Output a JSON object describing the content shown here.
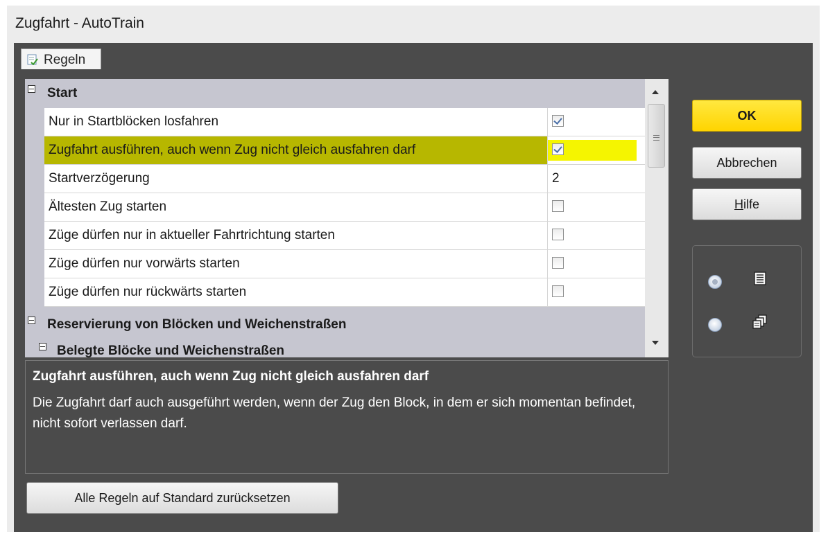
{
  "window": {
    "title": "Zugfahrt - AutoTrain"
  },
  "tabs": [
    {
      "label": "Regeln"
    }
  ],
  "grid": {
    "categories": [
      {
        "label": "Start"
      },
      {
        "label": "Reservierung von Blöcken und Weichenstraßen"
      },
      {
        "label": "Belegte Blöcke und Weichenstraßen"
      }
    ],
    "rows": [
      {
        "label": "Nur in Startblöcken losfahren",
        "checked": true
      },
      {
        "label": "Zugfahrt ausführen, auch wenn Zug nicht gleich ausfahren darf",
        "checked": true,
        "selected": true
      },
      {
        "label": "Startverzögerung",
        "value": "2"
      },
      {
        "label": "Ältesten Zug starten",
        "checked": false
      },
      {
        "label": "Züge dürfen nur in aktueller Fahrtrichtung starten",
        "checked": false
      },
      {
        "label": "Züge dürfen nur vorwärts starten",
        "checked": false
      },
      {
        "label": "Züge dürfen nur rückwärts starten",
        "checked": false
      }
    ]
  },
  "description": {
    "title": "Zugfahrt ausführen, auch wenn Zug nicht gleich ausfahren darf",
    "text": "Die Zugfahrt darf auch ausgeführt werden, wenn der Zug den Block, in dem er sich momentan befindet, nicht sofort verlassen darf."
  },
  "buttons": {
    "ok": "OK",
    "cancel": "Abbrechen",
    "help_accel": "H",
    "help_rest": "ilfe",
    "reset": "Alle Regeln auf Standard zurücksetzen"
  },
  "view_options": {
    "selected": "list",
    "icons": [
      "list-view-icon",
      "category-view-icon"
    ]
  },
  "colors": {
    "selected_row": "#b7b700",
    "selected_value": "#f5f500",
    "ok_button": "#ffd400",
    "dialog_background": "#4b4b4b"
  }
}
